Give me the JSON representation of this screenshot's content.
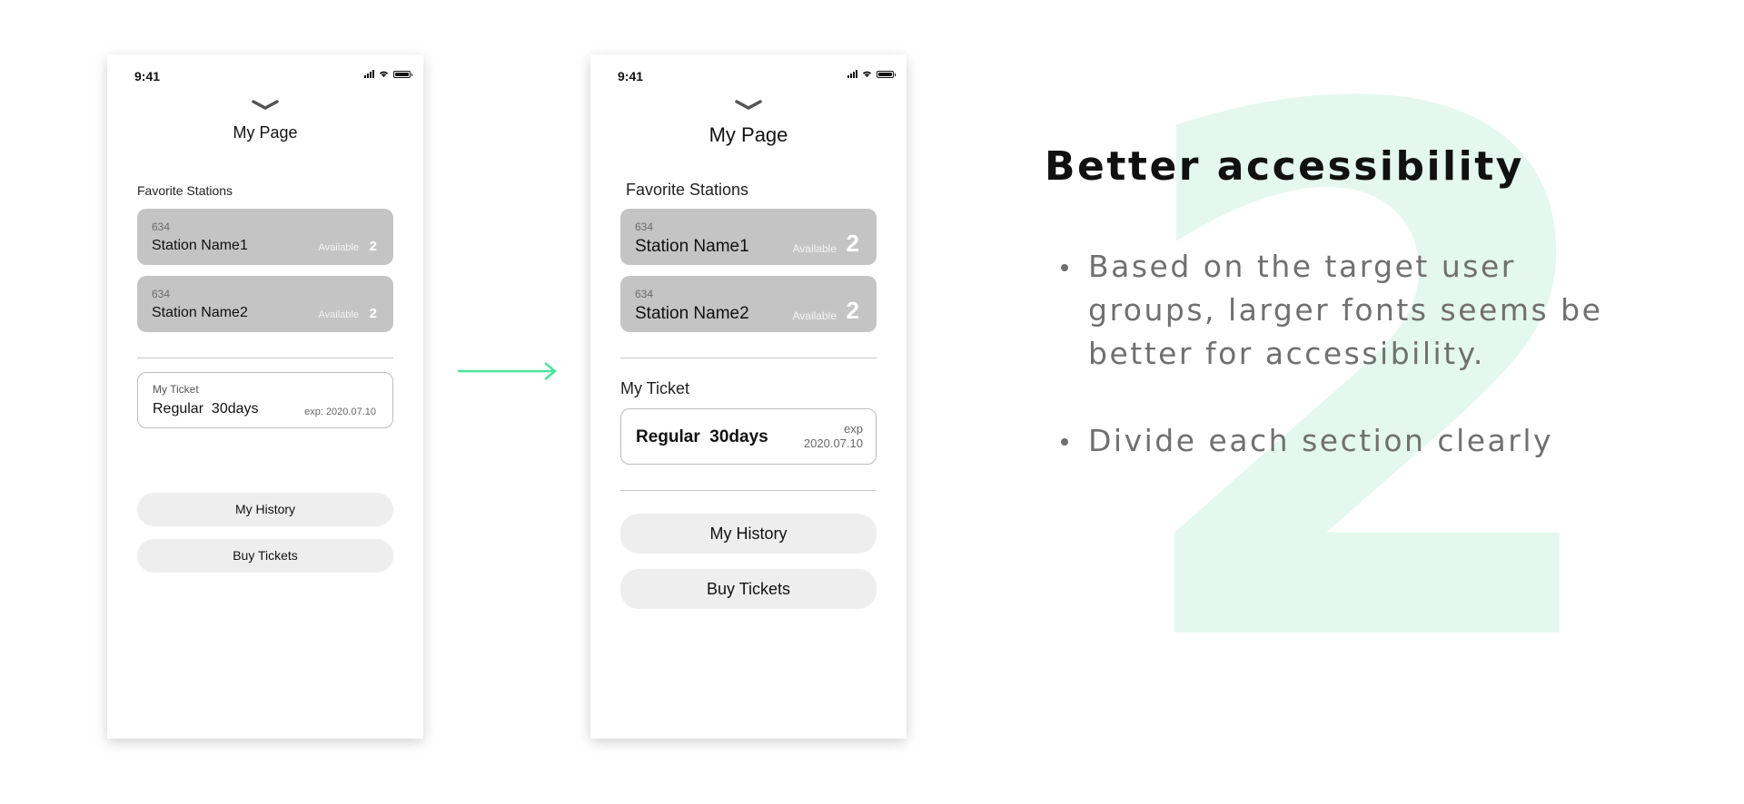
{
  "before": {
    "time": "9:41",
    "title": "My Page",
    "favorites_label": "Favorite Stations",
    "stations": [
      {
        "id": "634",
        "name": "Station Name1",
        "available_label": "Available",
        "available_count": "2"
      },
      {
        "id": "634",
        "name": "Station Name2",
        "available_label": "Available",
        "available_count": "2"
      }
    ],
    "ticket": {
      "label": "My Ticket",
      "name": "Regular  30days",
      "exp": "exp: 2020.07.10"
    },
    "buttons": {
      "history": "My History",
      "buy": "Buy Tickets"
    }
  },
  "after": {
    "time": "9:41",
    "title": "My Page",
    "favorites_label": "Favorite Stations",
    "stations": [
      {
        "id": "634",
        "name": "Station Name1",
        "available_label": "Available",
        "available_count": "2"
      },
      {
        "id": "634",
        "name": "Station Name2",
        "available_label": "Available",
        "available_count": "2"
      }
    ],
    "ticket": {
      "label": "My Ticket",
      "name": "Regular  30days",
      "exp_label": "exp",
      "exp_date": "2020.07.10"
    },
    "buttons": {
      "history": "My History",
      "buy": "Buy Tickets"
    }
  },
  "panel": {
    "big_number": "2",
    "heading": "Better accessibility",
    "bullets": [
      "Based on the target user groups, larger fonts seems be better for accessibility.",
      "Divide each section clearly"
    ]
  },
  "colors": {
    "arrow": "#4de39a",
    "card_gray": "#c4c4c4",
    "button_gray": "#eeeeee",
    "big_number": "#e4f8ef"
  },
  "icons": [
    "chevron-down-icon",
    "signal-icon",
    "wifi-icon",
    "battery-icon",
    "arrow-right-icon"
  ]
}
